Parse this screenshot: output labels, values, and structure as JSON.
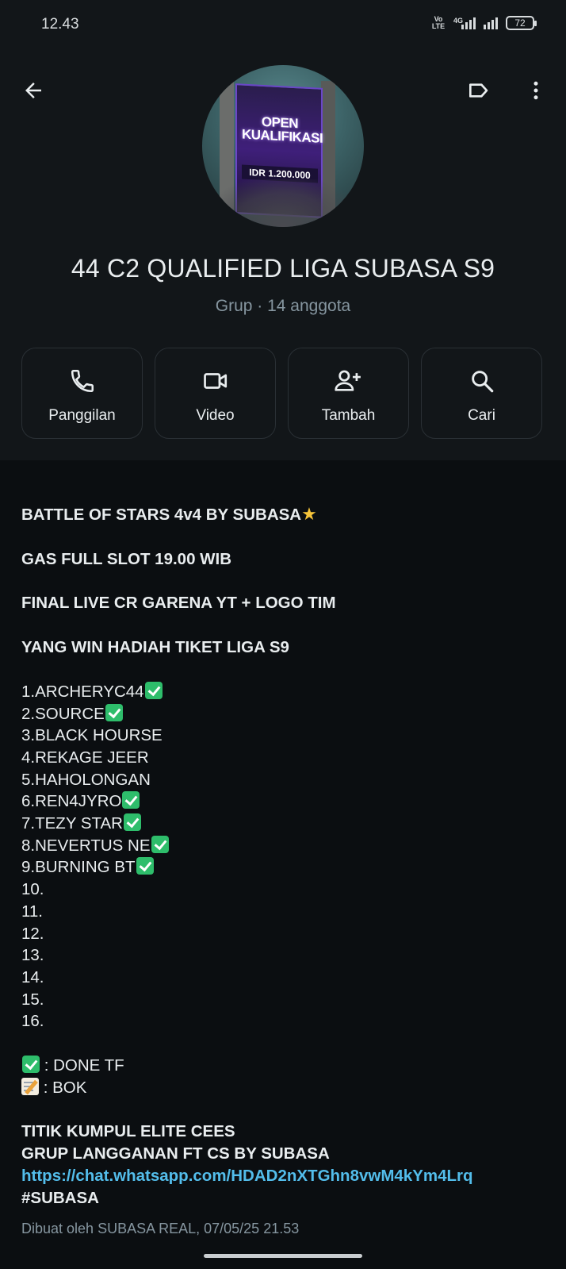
{
  "status_bar": {
    "time": "12.43",
    "volte_top": "Vo",
    "volte_bottom": "LTE",
    "network": "4G",
    "battery": "72"
  },
  "header": {
    "group_name": "44 C2 QUALIFIED LIGA SUBASA S9",
    "subtitle": "Grup · 14 anggota",
    "avatar_text": {
      "headline": "OPEN KUALIFIKASI",
      "prize": "IDR 1.200.000"
    },
    "actions": [
      {
        "label": "Panggilan",
        "icon": "phone-icon"
      },
      {
        "label": "Video",
        "icon": "video-icon"
      },
      {
        "label": "Tambah",
        "icon": "add-person-icon"
      },
      {
        "label": "Cari",
        "icon": "search-icon"
      }
    ]
  },
  "description": {
    "line1": "BATTLE OF STARS  4v4 BY SUBASA",
    "line2": "GAS FULL SLOT 19.00 WIB",
    "line3": "FINAL LIVE CR GARENA YT + LOGO TIM",
    "line4": "YANG WIN HADIAH TIKET LIGA S9",
    "slots": [
      "1.ARCHERYC44",
      "2.SOURCE",
      "3.BLACK HOURSE",
      "4.REKAGE JEER",
      "5.HAHOLONGAN",
      "6.REN4JYRO",
      "7.TEZY STAR",
      "8.NEVERTUS NE",
      "9.BURNING BT",
      "10.",
      "11.",
      "12.",
      "13.",
      "14.",
      "15.",
      "16."
    ],
    "legend_done": " : DONE TF",
    "legend_bok": " : BOK",
    "footer1": "TITIK KUMPUL ELITE CEES",
    "footer2": "GRUP LANGGANAN FT CS BY SUBASA",
    "link": "https://chat.whatsapp.com/HDAD2nXTGhn8vwM4kYm4Lrq",
    "hashtag": "#SUBASA"
  },
  "created_by": "Dibuat oleh SUBASA REAL, 07/05/25 21.53"
}
